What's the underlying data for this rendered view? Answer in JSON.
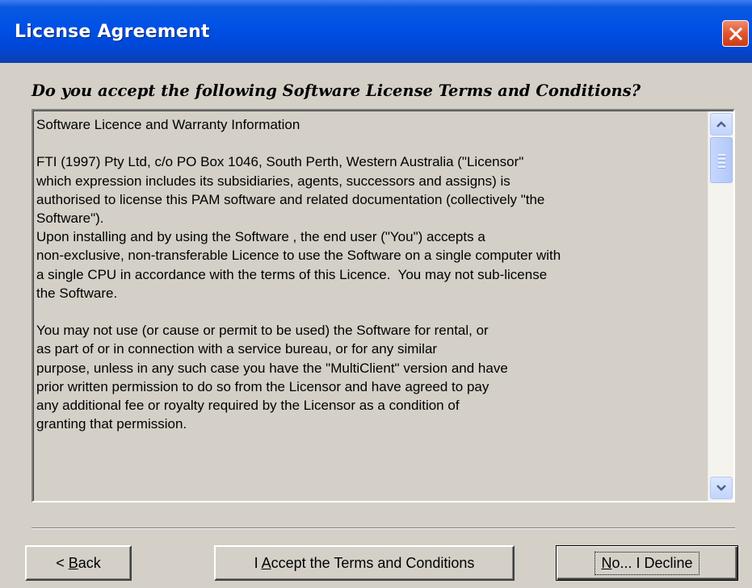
{
  "window": {
    "title": "License Agreement"
  },
  "question": "Do you accept the following Software License Terms and Conditions?",
  "license": {
    "lines": [
      "Software Licence and Warranty Information",
      "",
      "FTI (1997) Pty Ltd, c/o PO Box 1046, South Perth, Western Australia (\"Licensor\"",
      "which expression includes its subsidiaries, agents, successors and assigns) is",
      "authorised to license this PAM software and related documentation (collectively \"the",
      "Software\").",
      "Upon installing and by using the Software , the end user (\"You\") accepts a",
      "non-exclusive, non-transferable Licence to use the Software on a single computer with",
      "a single CPU in accordance with the terms of this Licence.  You may not sub-license",
      "the Software.",
      "",
      "You may not use (or cause or permit to be used) the Software for rental, or",
      "as part of or in connection with a service bureau, or for any similar",
      "purpose, unless in any such case you have the \"MultiClient\" version and have",
      "prior written permission to do so from the Licensor and have agreed to pay",
      "any additional fee or royalty required by the Licensor as a condition of",
      "granting that permission."
    ]
  },
  "buttons": {
    "back": {
      "pre": "< ",
      "accel": "B",
      "post": "ack"
    },
    "accept": {
      "pre": "I ",
      "accel": "A",
      "post": "ccept the Terms and Conditions"
    },
    "decline": {
      "pre": "",
      "accel": "N",
      "post": "o... I Decline"
    }
  },
  "colors": {
    "titlebar": "#0052e6",
    "close_button": "#e0552f",
    "dialog_face": "#d4d0c8",
    "scrollbar_accent": "#c3d4fc"
  },
  "icons": {
    "close": "close-icon",
    "scroll_up": "chevron-up-icon",
    "scroll_down": "chevron-down-icon"
  }
}
